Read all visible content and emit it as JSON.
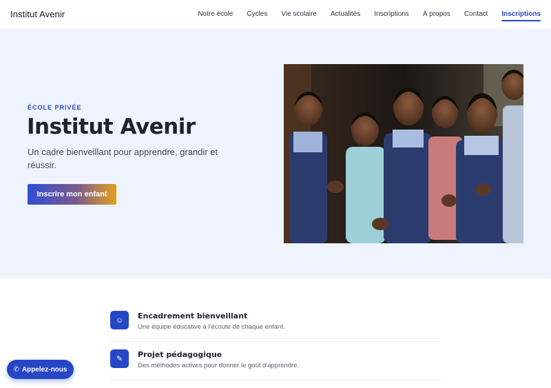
{
  "header": {
    "brand": "Institut Avenir",
    "nav": [
      {
        "label": "Notre école"
      },
      {
        "label": "Cycles"
      },
      {
        "label": "Vie scolaire"
      },
      {
        "label": "Actualités"
      },
      {
        "label": "Inscriptions"
      },
      {
        "label": "À propos"
      },
      {
        "label": "Contact"
      },
      {
        "label": "Inscriptions",
        "active": true
      }
    ]
  },
  "hero": {
    "eyebrow": "ÉCOLE PRIVÉE",
    "title": "Institut Avenir",
    "subtitle": "Un cadre bienveillant pour apprendre, grandir et réussir.",
    "cta_label": "Inscrire mon enfant",
    "photo_icon": "children-classroom-photo"
  },
  "features": [
    {
      "icon": "smiley-icon",
      "glyph": "☺",
      "title": "Encadrement bienveillant",
      "desc": "Une équipe éducative à l'écoute de chaque enfant."
    },
    {
      "icon": "pencil-icon",
      "glyph": "✎",
      "title": "Projet pédagogique",
      "desc": "Des méthodes actives pour donner le goût d'apprendre."
    }
  ],
  "floating": {
    "call_label": "Appelez-nous",
    "call_glyph": "✆"
  },
  "colors": {
    "accent": "#2547c4",
    "hero_bg": "#eef3fd",
    "cta_gradient_start": "#2f4fd0",
    "cta_gradient_end": "#e3a11d"
  }
}
